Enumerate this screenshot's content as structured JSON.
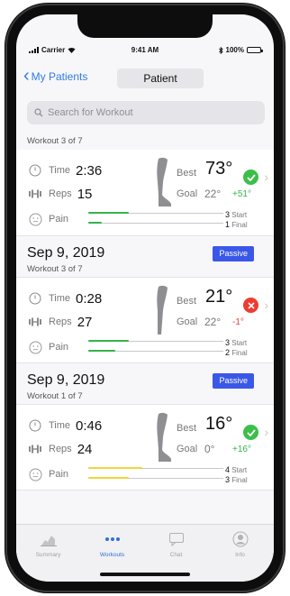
{
  "status_bar": {
    "carrier": "Carrier",
    "time": "9:41 AM",
    "battery": "100%"
  },
  "nav": {
    "back_label": "My Patients",
    "title": "Patient"
  },
  "search": {
    "placeholder": "Search for Workout"
  },
  "workouts": [
    {
      "date": "",
      "workout": "Workout 3 of 7",
      "mode": "",
      "time_label": "Time",
      "time": "2:36",
      "reps_label": "Reps",
      "reps": "15",
      "best_label": "Best",
      "best": "73°",
      "goal_label": "Goal",
      "goal": "22°",
      "delta": "+51°",
      "result": "achieved",
      "pain_label": "Pain",
      "pain_start": "3",
      "pain_final": "1",
      "pain_start_label": "Start",
      "pain_final_label": "Final",
      "pain_start_level": 0.3,
      "pain_final_level": 0.1,
      "pain_color": "#38b24a"
    },
    {
      "date": "Sep 9, 2019",
      "workout": "Workout 3 of 7",
      "mode": "Passive",
      "time_label": "Time",
      "time": "0:28",
      "reps_label": "Reps",
      "reps": "27",
      "best_label": "Best",
      "best": "21°",
      "goal_label": "Goal",
      "goal": "22°",
      "delta": "-1°",
      "result": "missed",
      "pain_label": "Pain",
      "pain_start": "3",
      "pain_final": "2",
      "pain_start_label": "Start",
      "pain_final_label": "Final",
      "pain_start_level": 0.3,
      "pain_final_level": 0.2,
      "pain_color": "#38b24a"
    },
    {
      "date": "Sep 9, 2019",
      "workout": "Workout 1 of 7",
      "mode": "Passive",
      "time_label": "Time",
      "time": "0:46",
      "reps_label": "Reps",
      "reps": "24",
      "best_label": "Best",
      "best": "16°",
      "goal_label": "Goal",
      "goal": "0°",
      "delta": "+16°",
      "result": "achieved",
      "pain_label": "Pain",
      "pain_start": "4",
      "pain_final": "3",
      "pain_start_label": "Start",
      "pain_final_label": "Final",
      "pain_start_level": 0.4,
      "pain_final_level": 0.3,
      "pain_color": "#f2d43c"
    }
  ],
  "tabs": [
    {
      "label": "Summary",
      "icon": "chart-icon",
      "active": false
    },
    {
      "label": "Workouts",
      "icon": "dots-icon",
      "active": true
    },
    {
      "label": "Chat",
      "icon": "chat-icon",
      "active": false
    },
    {
      "label": "Info",
      "icon": "person-icon",
      "active": false
    }
  ],
  "colors": {
    "accent": "#2f7ae5",
    "badge": "#3b57e8",
    "success": "#3cbf4a",
    "error": "#ee3c33"
  }
}
